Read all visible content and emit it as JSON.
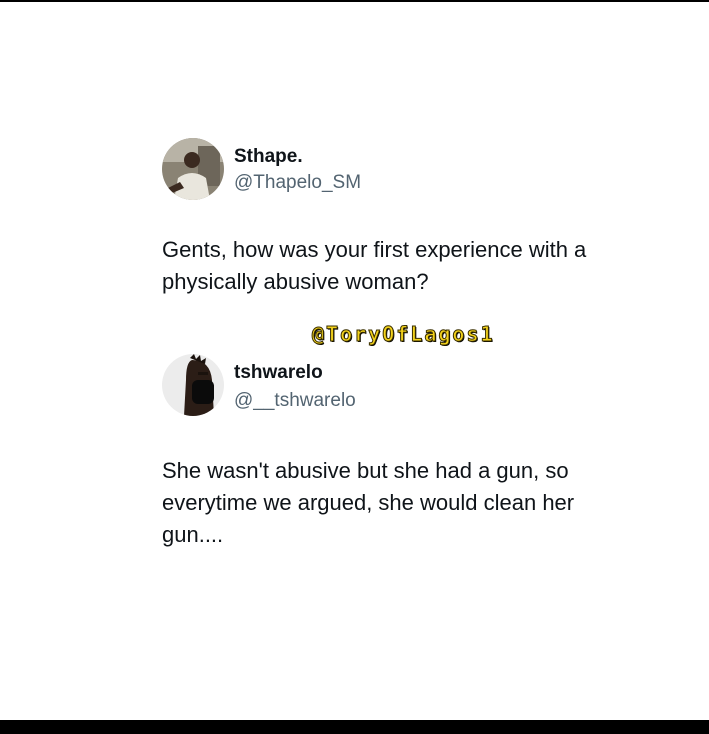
{
  "watermark": "@ToryOfLagos1",
  "tweets": [
    {
      "display_name": "Sthape.",
      "handle": "@Thapelo_SM",
      "text_lines": [
        "Gents, how was your first experience with a",
        "physically abusive woman?"
      ]
    },
    {
      "display_name": "tshwarelo",
      "handle": "@__tshwarelo",
      "text_lines": [
        "She wasn't abusive but she had a gun, so",
        "everytime we argued, she would clean her",
        "gun...."
      ]
    }
  ]
}
